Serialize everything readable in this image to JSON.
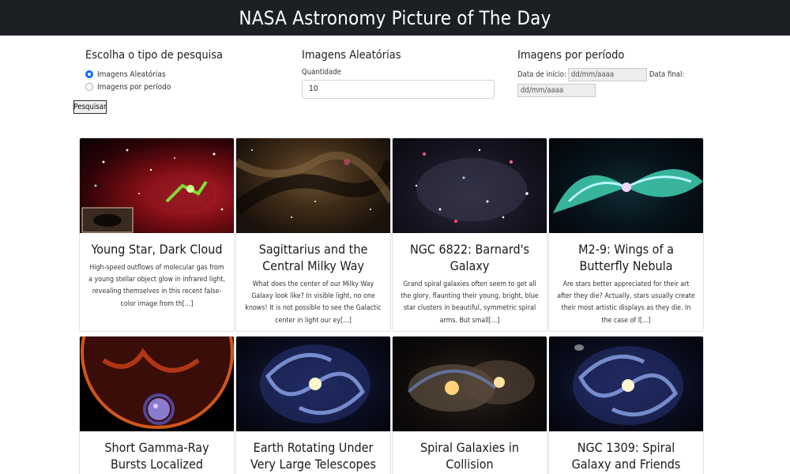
{
  "header": {
    "title": "NASA Astronomy Picture of The Day"
  },
  "search_type": {
    "heading": "Escolha o tipo de pesquisa",
    "options": [
      {
        "label": "Imagens Aleatórias",
        "checked": true
      },
      {
        "label": "Imagens por período",
        "checked": false
      }
    ],
    "button_label": "Pesquisar"
  },
  "random": {
    "heading": "Imagens Aleatórias",
    "quantity_label": "Quantidade",
    "quantity_value": "10"
  },
  "period": {
    "heading": "Imagens por período",
    "start_label": "Data de início:",
    "start_placeholder": "dd/mm/aaaa",
    "end_label": "Data final:",
    "end_placeholder": "dd/mm/aaaa"
  },
  "cards": [
    {
      "title": "Young Star, Dark Cloud",
      "desc": "High-speed outflows of molecular gas from a young stellar object glow in infrared light, revealing themselves in this recent false-color image from th[...]"
    },
    {
      "title": "Sagittarius and the Central Milky Way",
      "desc": "What does the center of our Milky Way Galaxy look like? In visible light, no one knows! It is not possible to see the Galactic center in light our ey[...]"
    },
    {
      "title": "NGC 6822: Barnard's Galaxy",
      "desc": "Grand spiral galaxies often seem to get all the glory, flaunting their young, bright, blue star clusters in beautiful, symmetric spiral arms. But small[...]"
    },
    {
      "title": "M2-9: Wings of a Butterfly Nebula",
      "desc": "Are stars better appreciated for their art after they die? Actually, stars usually create their most artistic displays as they die. In the case of l[...]"
    },
    {
      "title": "Short Gamma-Ray Bursts Localized",
      "desc": ""
    },
    {
      "title": "Earth Rotating Under Very Large Telescopes",
      "desc": ""
    },
    {
      "title": "Spiral Galaxies in Collision",
      "desc": ""
    },
    {
      "title": "NGC 1309: Spiral Galaxy and Friends",
      "desc": ""
    }
  ]
}
